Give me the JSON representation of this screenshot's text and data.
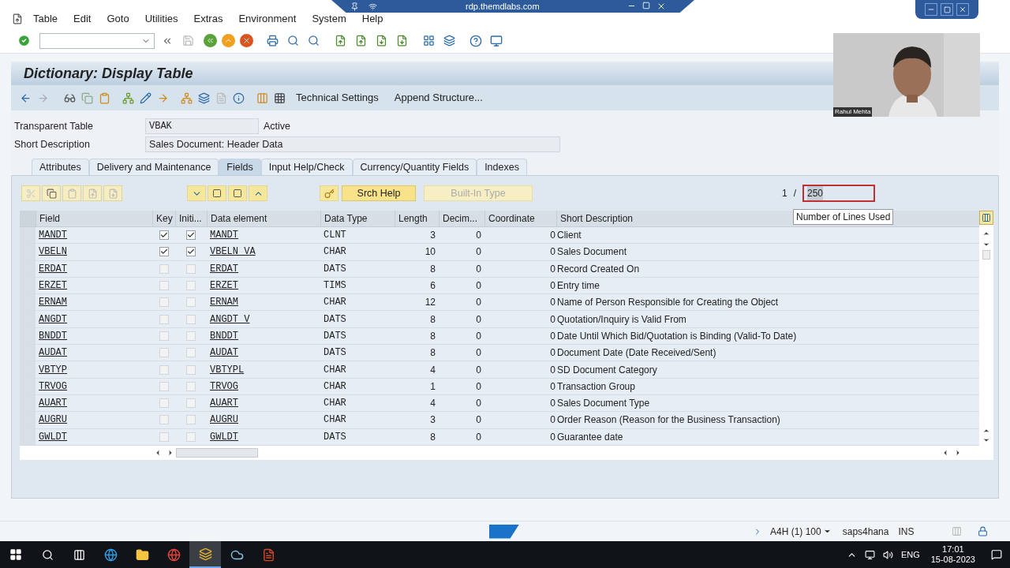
{
  "rdp_bar": {
    "title": "rdp.themdlabs.com"
  },
  "menu": [
    "Table",
    "Edit",
    "Goto",
    "Utilities",
    "Extras",
    "Environment",
    "System",
    "Help"
  ],
  "title": "Dictionary: Display Table",
  "app_toolbar": [
    "Technical Settings",
    "Append Structure..."
  ],
  "form": {
    "table_label": "Transparent Table",
    "table_value": "VBAK",
    "table_status": "Active",
    "desc_label": "Short Description",
    "desc_value": "Sales Document: Header Data"
  },
  "tabs": [
    {
      "label": "Attributes",
      "selected": false
    },
    {
      "label": "Delivery and Maintenance",
      "selected": false
    },
    {
      "label": "Fields",
      "selected": true
    },
    {
      "label": "Input Help/Check",
      "selected": false
    },
    {
      "label": "Currency/Quantity Fields",
      "selected": false
    },
    {
      "label": "Indexes",
      "selected": false
    }
  ],
  "table_buttons": [
    {
      "label": "Srch Help",
      "disabled": false
    },
    {
      "label": "Built-In Type",
      "disabled": true
    }
  ],
  "counter": {
    "current": "1",
    "separator": "/",
    "total": "250"
  },
  "tooltip": "Number of Lines Used",
  "columns": [
    "Field",
    "Key",
    "Initi...",
    "Data element",
    "Data Type",
    "Length",
    "Decim...",
    "Coordinate",
    "Short Description"
  ],
  "rows": [
    {
      "field": "MANDT",
      "key": true,
      "initial": true,
      "data_element": "MANDT",
      "data_type": "CLNT",
      "length": "3",
      "decimals": "0",
      "coordinate": "0",
      "description": "Client"
    },
    {
      "field": "VBELN",
      "key": true,
      "initial": true,
      "data_element": "VBELN_VA",
      "data_type": "CHAR",
      "length": "10",
      "decimals": "0",
      "coordinate": "0",
      "description": "Sales Document"
    },
    {
      "field": "ERDAT",
      "key": false,
      "initial": false,
      "data_element": "ERDAT",
      "data_type": "DATS",
      "length": "8",
      "decimals": "0",
      "coordinate": "0",
      "description": "Record Created On"
    },
    {
      "field": "ERZET",
      "key": false,
      "initial": false,
      "data_element": "ERZET",
      "data_type": "TIMS",
      "length": "6",
      "decimals": "0",
      "coordinate": "0",
      "description": "Entry time"
    },
    {
      "field": "ERNAM",
      "key": false,
      "initial": false,
      "data_element": "ERNAM",
      "data_type": "CHAR",
      "length": "12",
      "decimals": "0",
      "coordinate": "0",
      "description": "Name of Person Responsible for Creating the Object"
    },
    {
      "field": "ANGDT",
      "key": false,
      "initial": false,
      "data_element": "ANGDT_V",
      "data_type": "DATS",
      "length": "8",
      "decimals": "0",
      "coordinate": "0",
      "description": "Quotation/Inquiry is Valid From"
    },
    {
      "field": "BNDDT",
      "key": false,
      "initial": false,
      "data_element": "BNDDT",
      "data_type": "DATS",
      "length": "8",
      "decimals": "0",
      "coordinate": "0",
      "description": "Date Until Which Bid/Quotation is Binding (Valid-To Date)"
    },
    {
      "field": "AUDAT",
      "key": false,
      "initial": false,
      "data_element": "AUDAT",
      "data_type": "DATS",
      "length": "8",
      "decimals": "0",
      "coordinate": "0",
      "description": "Document Date (Date Received/Sent)"
    },
    {
      "field": "VBTYP",
      "key": false,
      "initial": false,
      "data_element": "VBTYPL",
      "data_type": "CHAR",
      "length": "4",
      "decimals": "0",
      "coordinate": "0",
      "description": "SD Document Category"
    },
    {
      "field": "TRVOG",
      "key": false,
      "initial": false,
      "data_element": "TRVOG",
      "data_type": "CHAR",
      "length": "1",
      "decimals": "0",
      "coordinate": "0",
      "description": "Transaction Group"
    },
    {
      "field": "AUART",
      "key": false,
      "initial": false,
      "data_element": "AUART",
      "data_type": "CHAR",
      "length": "4",
      "decimals": "0",
      "coordinate": "0",
      "description": "Sales Document Type"
    },
    {
      "field": "AUGRU",
      "key": false,
      "initial": false,
      "data_element": "AUGRU",
      "data_type": "CHAR",
      "length": "3",
      "decimals": "0",
      "coordinate": "0",
      "description": "Order Reason (Reason for the Business Transaction)"
    },
    {
      "field": "GWLDT",
      "key": false,
      "initial": false,
      "data_element": "GWLDT",
      "data_type": "DATS",
      "length": "8",
      "decimals": "0",
      "coordinate": "0",
      "description": "Guarantee date"
    }
  ],
  "status_bar": {
    "system": "A4H (1) 100",
    "server": "saps4hana",
    "mode": "INS"
  },
  "webcam": {
    "name": "Rahul Mehta"
  },
  "taskbar": {
    "language": "ENG",
    "time": "17:01",
    "date": "15-08-2023"
  }
}
